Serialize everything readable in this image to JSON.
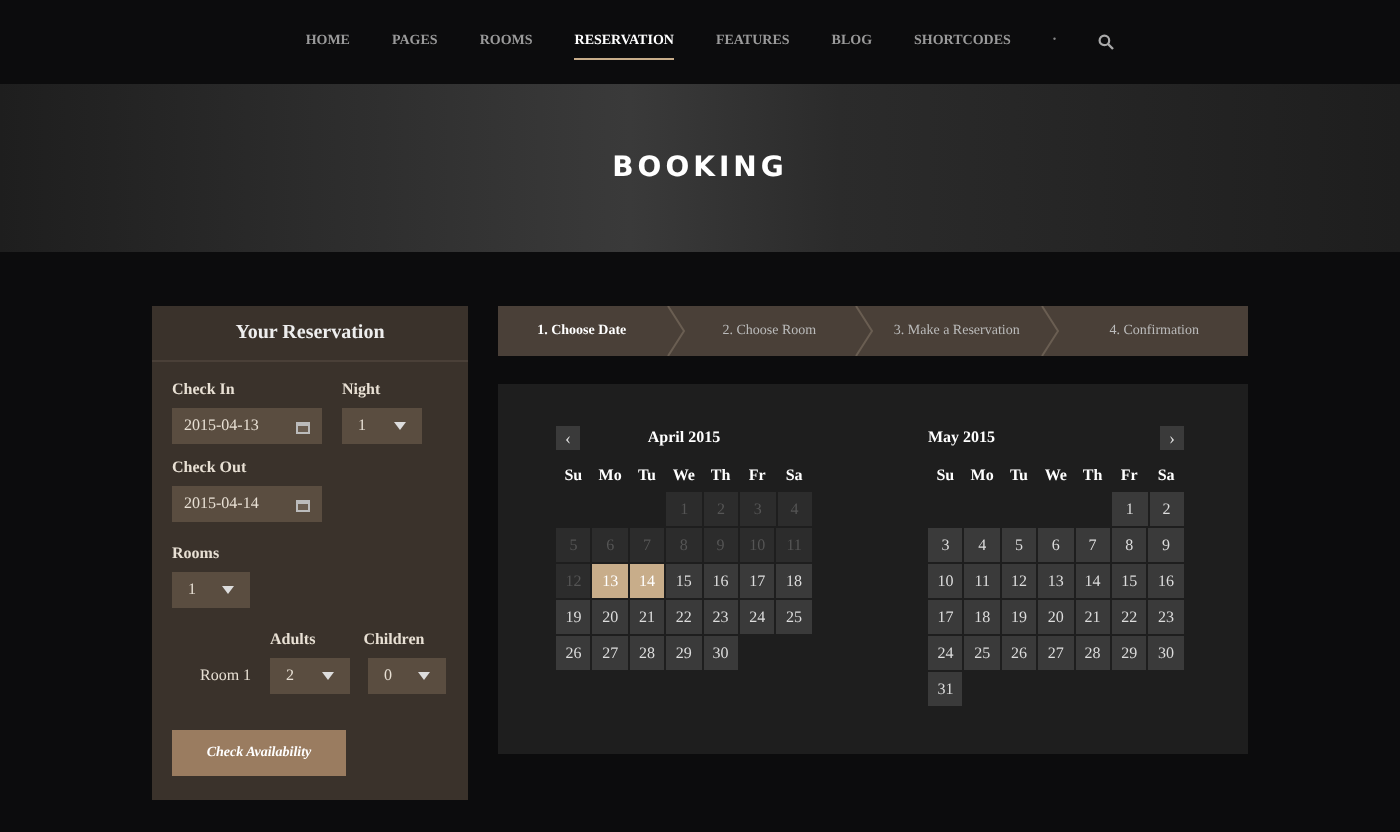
{
  "nav": {
    "items": [
      {
        "label": "HOME",
        "selected": false
      },
      {
        "label": "PAGES",
        "selected": false
      },
      {
        "label": "ROOMS",
        "selected": false
      },
      {
        "label": "RESERVATION",
        "selected": true
      },
      {
        "label": "FEATURES",
        "selected": false
      },
      {
        "label": "BLOG",
        "selected": false
      },
      {
        "label": "SHORTCODES",
        "selected": false
      }
    ],
    "dot": "•"
  },
  "hero": {
    "title": "BOOKING"
  },
  "reservation": {
    "title": "Your Reservation",
    "check_in": {
      "label": "Check In",
      "value": "2015-04-13"
    },
    "night": {
      "label": "Night",
      "value": "1"
    },
    "check_out": {
      "label": "Check Out",
      "value": "2015-04-14"
    },
    "rooms": {
      "label": "Rooms",
      "value": "1"
    },
    "adults_label": "Adults",
    "children_label": "Children",
    "room_rows": [
      {
        "label": "Room 1",
        "adults": "2",
        "children": "0"
      }
    ],
    "button": "Check Availability"
  },
  "steps": [
    {
      "label": "1. Choose Date",
      "selected": true
    },
    {
      "label": "2. Choose Room",
      "selected": false
    },
    {
      "label": "3. Make a Reservation",
      "selected": false
    },
    {
      "label": "4. Confirmation",
      "selected": false
    }
  ],
  "calendars": [
    {
      "title": "April 2015",
      "nav_button": {
        "kind": "prev",
        "label": "‹"
      },
      "weekdays": [
        "Su",
        "Mo",
        "Tu",
        "We",
        "Th",
        "Fr",
        "Sa"
      ],
      "weeks": [
        {
          "kind": "leading",
          "days": [
            {
              "day": "1",
              "disabled": true,
              "selected": false
            },
            {
              "day": "2",
              "disabled": true,
              "selected": false
            },
            {
              "day": "3",
              "disabled": true,
              "selected": false
            },
            {
              "day": "4",
              "disabled": true,
              "selected": false
            }
          ]
        },
        {
          "kind": "regular",
          "days": [
            {
              "day": "5",
              "disabled": true,
              "selected": false
            },
            {
              "day": "6",
              "disabled": true,
              "selected": false
            },
            {
              "day": "7",
              "disabled": true,
              "selected": false
            },
            {
              "day": "8",
              "disabled": true,
              "selected": false
            },
            {
              "day": "9",
              "disabled": true,
              "selected": false
            },
            {
              "day": "10",
              "disabled": true,
              "selected": false
            },
            {
              "day": "11",
              "disabled": true,
              "selected": false
            }
          ]
        },
        {
          "kind": "regular",
          "days": [
            {
              "day": "12",
              "disabled": true,
              "selected": false
            },
            {
              "day": "13",
              "disabled": false,
              "selected": true
            },
            {
              "day": "14",
              "disabled": false,
              "selected": true
            },
            {
              "day": "15",
              "disabled": false,
              "selected": false
            },
            {
              "day": "16",
              "disabled": false,
              "selected": false
            },
            {
              "day": "17",
              "disabled": false,
              "selected": false
            },
            {
              "day": "18",
              "disabled": false,
              "selected": false
            }
          ]
        },
        {
          "kind": "regular",
          "days": [
            {
              "day": "19",
              "disabled": false,
              "selected": false
            },
            {
              "day": "20",
              "disabled": false,
              "selected": false
            },
            {
              "day": "21",
              "disabled": false,
              "selected": false
            },
            {
              "day": "22",
              "disabled": false,
              "selected": false
            },
            {
              "day": "23",
              "disabled": false,
              "selected": false
            },
            {
              "day": "24",
              "disabled": false,
              "selected": false
            },
            {
              "day": "25",
              "disabled": false,
              "selected": false
            }
          ]
        },
        {
          "kind": "regular",
          "days": [
            {
              "day": "26",
              "disabled": false,
              "selected": false
            },
            {
              "day": "27",
              "disabled": false,
              "selected": false
            },
            {
              "day": "28",
              "disabled": false,
              "selected": false
            },
            {
              "day": "29",
              "disabled": false,
              "selected": false
            },
            {
              "day": "30",
              "disabled": false,
              "selected": false
            }
          ]
        }
      ]
    },
    {
      "title": "May 2015",
      "nav_button": {
        "kind": "next",
        "label": "›"
      },
      "weekdays": [
        "Su",
        "Mo",
        "Tu",
        "We",
        "Th",
        "Fr",
        "Sa"
      ],
      "weeks": [
        {
          "kind": "leading",
          "days": [
            {
              "day": "1",
              "disabled": false,
              "selected": false
            },
            {
              "day": "2",
              "disabled": false,
              "selected": false
            }
          ]
        },
        {
          "kind": "regular",
          "days": [
            {
              "day": "3",
              "disabled": false,
              "selected": false
            },
            {
              "day": "4",
              "disabled": false,
              "selected": false
            },
            {
              "day": "5",
              "disabled": false,
              "selected": false
            },
            {
              "day": "6",
              "disabled": false,
              "selected": false
            },
            {
              "day": "7",
              "disabled": false,
              "selected": false
            },
            {
              "day": "8",
              "disabled": false,
              "selected": false
            },
            {
              "day": "9",
              "disabled": false,
              "selected": false
            }
          ]
        },
        {
          "kind": "regular",
          "days": [
            {
              "day": "10",
              "disabled": false,
              "selected": false
            },
            {
              "day": "11",
              "disabled": false,
              "selected": false
            },
            {
              "day": "12",
              "disabled": false,
              "selected": false
            },
            {
              "day": "13",
              "disabled": false,
              "selected": false
            },
            {
              "day": "14",
              "disabled": false,
              "selected": false
            },
            {
              "day": "15",
              "disabled": false,
              "selected": false
            },
            {
              "day": "16",
              "disabled": false,
              "selected": false
            }
          ]
        },
        {
          "kind": "regular",
          "days": [
            {
              "day": "17",
              "disabled": false,
              "selected": false
            },
            {
              "day": "18",
              "disabled": false,
              "selected": false
            },
            {
              "day": "19",
              "disabled": false,
              "selected": false
            },
            {
              "day": "20",
              "disabled": false,
              "selected": false
            },
            {
              "day": "21",
              "disabled": false,
              "selected": false
            },
            {
              "day": "22",
              "disabled": false,
              "selected": false
            },
            {
              "day": "23",
              "disabled": false,
              "selected": false
            }
          ]
        },
        {
          "kind": "regular",
          "days": [
            {
              "day": "24",
              "disabled": false,
              "selected": false
            },
            {
              "day": "25",
              "disabled": false,
              "selected": false
            },
            {
              "day": "26",
              "disabled": false,
              "selected": false
            },
            {
              "day": "27",
              "disabled": false,
              "selected": false
            },
            {
              "day": "28",
              "disabled": false,
              "selected": false
            },
            {
              "day": "29",
              "disabled": false,
              "selected": false
            },
            {
              "day": "30",
              "disabled": false,
              "selected": false
            }
          ]
        },
        {
          "kind": "regular",
          "days": [
            {
              "day": "31",
              "disabled": false,
              "selected": false
            }
          ]
        }
      ]
    }
  ]
}
